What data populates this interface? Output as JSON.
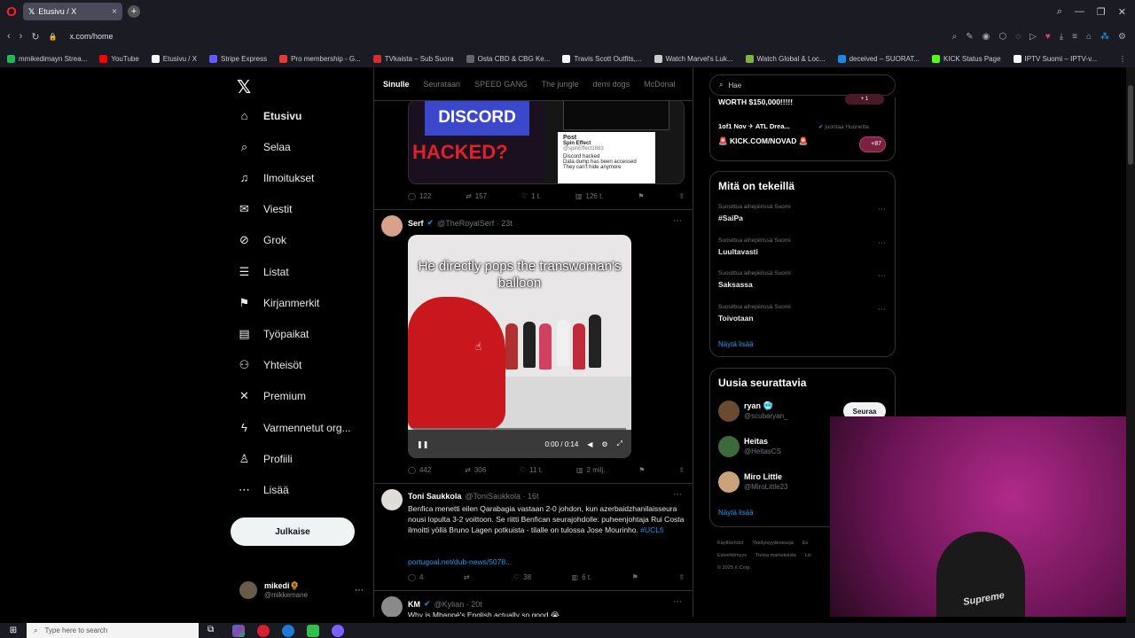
{
  "browser": {
    "tab_title": "Etusivu / X",
    "url": "x.com/home",
    "bookmarks": [
      {
        "label": "mmikedimayn Strea...",
        "color": "#1db954"
      },
      {
        "label": "YouTube",
        "color": "#ff0000"
      },
      {
        "label": "Etusivu / X",
        "color": "#ffffff"
      },
      {
        "label": "Stripe Express",
        "color": "#635bff"
      },
      {
        "label": "Pro membership - G...",
        "color": "#e53935"
      },
      {
        "label": "TVkaista – Sub Suora",
        "color": "#d32f2f"
      },
      {
        "label": "Osta CBD & CBG Ke...",
        "color": "#666666"
      },
      {
        "label": "Travis Scott Outfits,...",
        "color": "#ffffff"
      },
      {
        "label": "Watch Marvel's Luk...",
        "color": "#cccccc"
      },
      {
        "label": "Watch Global & Loc...",
        "color": "#7cb342"
      },
      {
        "label": "deceived – SUORAT...",
        "color": "#1e88e5"
      },
      {
        "label": "KICK Status Page",
        "color": "#53fc18"
      },
      {
        "label": "IPTV Suomi – IPTV-v...",
        "color": "#ffffff"
      }
    ]
  },
  "nav": {
    "items": [
      {
        "label": "Etusivu",
        "icon": "home-icon",
        "glyph": "⌂"
      },
      {
        "label": "Selaa",
        "icon": "search-icon",
        "glyph": "⌕"
      },
      {
        "label": "Ilmoitukset",
        "icon": "bell-icon",
        "glyph": "♫"
      },
      {
        "label": "Viestit",
        "icon": "mail-icon",
        "glyph": "✉"
      },
      {
        "label": "Grok",
        "icon": "grok-icon",
        "glyph": "⊘"
      },
      {
        "label": "Listat",
        "icon": "list-icon",
        "glyph": "☰"
      },
      {
        "label": "Kirjanmerkit",
        "icon": "bookmark-icon",
        "glyph": "⚑"
      },
      {
        "label": "Työpaikat",
        "icon": "briefcase-icon",
        "glyph": "▤"
      },
      {
        "label": "Yhteisöt",
        "icon": "communities-icon",
        "glyph": "⚇"
      },
      {
        "label": "Premium",
        "icon": "x-premium-icon",
        "glyph": "✕"
      },
      {
        "label": "Varmennetut org...",
        "icon": "lightning-icon",
        "glyph": "ϟ"
      },
      {
        "label": "Profiili",
        "icon": "profile-icon",
        "glyph": "♙"
      },
      {
        "label": "Lisää",
        "icon": "more-circle-icon",
        "glyph": "⋯"
      }
    ],
    "post_button": "Julkaise",
    "profile": {
      "name": "mikedi🌻",
      "handle": "@mikkemane"
    }
  },
  "feed": {
    "tabs": [
      "Sinulle",
      "Seurataan",
      "SPEED GANG",
      "The jungle",
      "demi dogs",
      "McDonal"
    ],
    "tweet1": {
      "image_title": "DISCORD",
      "image_subtitle": "HACKED?",
      "post_label": "Post",
      "post_user": "Spin Effect",
      "post_handle": "@spinEffect1883",
      "post_text1": "Discord hacked",
      "post_text2": "Data dump has been accessed",
      "post_text3": "They can't hide anymore",
      "replies": "122",
      "reposts": "157",
      "likes": "1 t.",
      "views": "126 t."
    },
    "tweet2": {
      "name": "Serf",
      "handle": "@TheRoyalSerf · 23t",
      "caption": "He directly pops the transwoman's balloon",
      "time": "0:00 / 0:14",
      "progress": 0.01,
      "replies": "442",
      "reposts": "306",
      "likes": "11 t.",
      "views": "2 milj."
    },
    "tweet3": {
      "name": "Toni Saukkola",
      "handle": "@ToniSaukkola · 16t",
      "text": "Benfica menetti eilen Qarabagia vastaan 2-0 johdon, kun azerbaidzhanilaisseura nousi lopulta 3-2 voittoon. Se riitti Benfican seurajohdolle: puheenjohtaja Rui Costa ilmoitti yöllä Bruno Lagen potkuista - tilalle on tulossa Jose Mourinho.",
      "hashtag": "#UCLfi",
      "link": "portugoal.net/dub-news/5078...",
      "replies": "4",
      "reposts": "",
      "likes": "38",
      "views": "6 t."
    },
    "tweet4": {
      "name": "KM",
      "handle": "@Kylian · 20t",
      "text": "Why is Mbappé's English actually so good 😭"
    }
  },
  "right": {
    "search_placeholder": "Hae",
    "live": {
      "line1": "WORTH $150,000!!!!!",
      "line2": "1of1 Nov ✈ ATL Drea...",
      "line2_extra": "juontaa Huonetta",
      "line3": "KICK.COM/NOVAD",
      "count": "+87",
      "badge": "+ 1"
    },
    "trends_title": "Mitä on tekeillä",
    "trends": [
      {
        "context": "Suosittua aihepiirissä Suomi",
        "name": "#SaiPa"
      },
      {
        "context": "Suosittua aihepiirissä Suomi",
        "name": "Luultavasti"
      },
      {
        "context": "Suosittua aihepiirissä Suomi",
        "name": "Saksassa"
      },
      {
        "context": "Suosittua aihepiirissä Suomi",
        "name": "Toivotaan"
      }
    ],
    "trends_more": "Näytä lisää",
    "follow_title": "Uusia seurattavia",
    "follows": [
      {
        "name": "ryan 🥶",
        "handle": "@scubaryan_",
        "color": "#6b4a32"
      },
      {
        "name": "Heitas",
        "handle": "@HeitasCS",
        "color": "#3c6a3c"
      },
      {
        "name": "Miro Little",
        "handle": "@MiroLittle23",
        "color": "#c9a27a"
      }
    ],
    "follow_button": "Seuraa",
    "follow_more": "Näytä lisää",
    "footer": [
      "Käyttöehdot",
      "Yksityisyydensuoja",
      "Ev",
      "Esteettömyys",
      "Tietoa mainoksista",
      "Lis",
      "© 2025 X Corp."
    ]
  },
  "webcam": {
    "brand": "Supreme"
  },
  "taskbar": {
    "search": "Type here to search"
  }
}
